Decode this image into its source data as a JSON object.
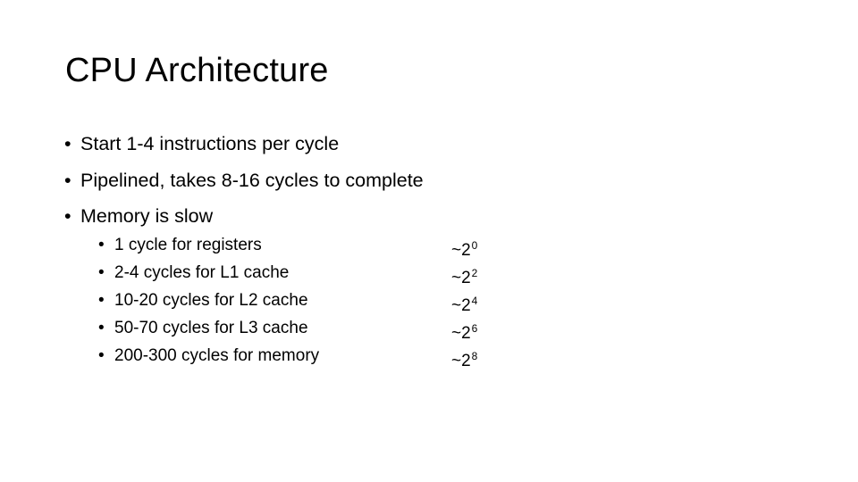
{
  "slide": {
    "title": "CPU Architecture",
    "bullet_glyph": "•",
    "bullets": [
      {
        "text": "Start 1-4 instructions per cycle"
      },
      {
        "text": "Pipelined, takes 8-16 cycles to complete"
      },
      {
        "text": "Memory is slow"
      }
    ],
    "sub_bullets": [
      {
        "text": "1 cycle for registers",
        "approx": "~2",
        "exponent": "0"
      },
      {
        "text": "2-4 cycles for L1 cache",
        "approx": "~2",
        "exponent": "2"
      },
      {
        "text": "10-20 cycles for L2 cache",
        "approx": "~2",
        "exponent": "4"
      },
      {
        "text": "50-70 cycles for L3 cache",
        "approx": "~2",
        "exponent": "6"
      },
      {
        "text": "200-300 cycles for memory",
        "approx": "~2",
        "exponent": "8"
      }
    ]
  }
}
